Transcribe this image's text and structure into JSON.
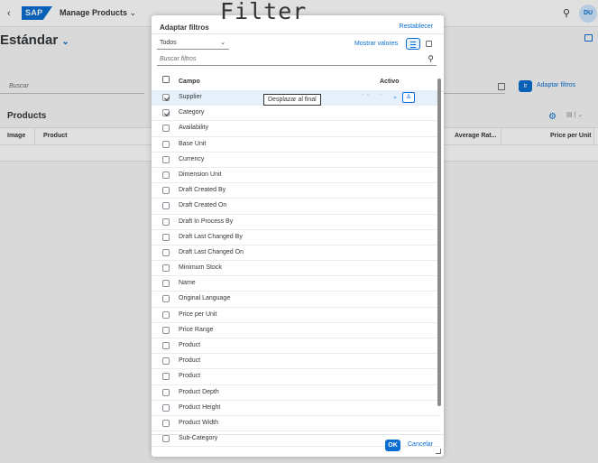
{
  "shell": {
    "back": "‹",
    "logo": "SAP",
    "app_title": "Manage Products",
    "app_title_chevron": "⌄",
    "search_icon": "⚲",
    "avatar": "DU"
  },
  "page": {
    "variant": "Estándar",
    "variant_chevron": "⌄",
    "search_placeholder": "Buscar",
    "go_label": "Ir",
    "adapt_filters_link": "Adaptar filtros"
  },
  "table": {
    "title": "Products",
    "columns": [
      "Image",
      "Product",
      "Average Rat...",
      "Price per Unit"
    ]
  },
  "dialog": {
    "title": "Adaptar filtros",
    "reset": "Restablecer",
    "select_value": "Todos",
    "show_values": "Mostrar valores",
    "search_placeholder": "Buscar filtros",
    "header_field": "Campo",
    "header_active": "Activo",
    "ok": "OK",
    "cancel": "Cancelar",
    "tooltip": "Desplazar al final",
    "row_actions": {
      "top": "⌃⌃",
      "up": "⌃",
      "down": "⌄",
      "bottom": "≚"
    },
    "items": [
      {
        "label": "Supplier",
        "checked": true,
        "selected": true
      },
      {
        "label": "Category",
        "checked": true
      },
      {
        "label": "Availability",
        "checked": false
      },
      {
        "label": "Base Unit",
        "checked": false
      },
      {
        "label": "Currency",
        "checked": false
      },
      {
        "label": "Dimension Unit",
        "checked": false
      },
      {
        "label": "Draft Created By",
        "checked": false
      },
      {
        "label": "Draft Created On",
        "checked": false
      },
      {
        "label": "Draft In Process By",
        "checked": false
      },
      {
        "label": "Draft Last Changed By",
        "checked": false
      },
      {
        "label": "Draft Last Changed On",
        "checked": false
      },
      {
        "label": "Minimum Stock",
        "checked": false
      },
      {
        "label": "Name",
        "checked": false
      },
      {
        "label": "Original Language",
        "checked": false
      },
      {
        "label": "Price per Unit",
        "checked": false
      },
      {
        "label": "Price Range",
        "checked": false
      },
      {
        "label": "Product",
        "checked": false
      },
      {
        "label": "Product",
        "checked": false
      },
      {
        "label": "Product",
        "checked": false
      },
      {
        "label": "Product Depth",
        "checked": false
      },
      {
        "label": "Product Height",
        "checked": false
      },
      {
        "label": "Product Width",
        "checked": false
      },
      {
        "label": "Sub-Category",
        "checked": false
      }
    ]
  },
  "watermark": "Filter",
  "colors": {
    "accent": "#0a6ed1",
    "selected_row": "#e5f0fa"
  }
}
